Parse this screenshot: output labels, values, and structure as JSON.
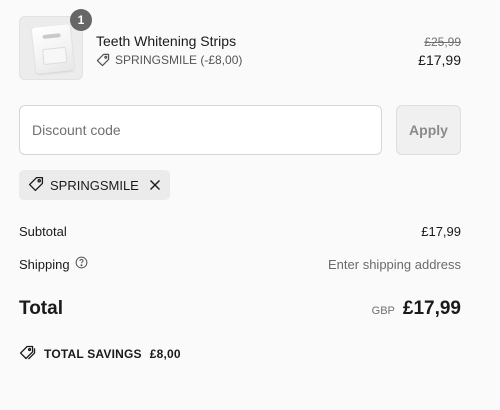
{
  "product": {
    "quantity": "1",
    "name": "Teeth Whitening Strips",
    "discount_label": "SPRINGSMILE (-£8,00)",
    "original_price": "£25,99",
    "price": "£17,99",
    "thumbnail_icon": "product-thumbnail"
  },
  "discount": {
    "placeholder": "Discount code",
    "value": "",
    "apply_label": "Apply",
    "applied_code": "SPRINGSMILE"
  },
  "summary": {
    "subtotal_label": "Subtotal",
    "subtotal_value": "£17,99",
    "shipping_label": "Shipping",
    "shipping_value": "Enter shipping address",
    "total_label": "Total",
    "total_currency": "GBP",
    "total_value": "£17,99",
    "savings_label": "TOTAL SAVINGS",
    "savings_value": "£8,00"
  },
  "colors": {
    "background": "#fafafa",
    "badge": "#666666",
    "chip": "#ebebeb",
    "text": "#1a1a1a",
    "muted": "#707070"
  },
  "icons": [
    "tag-icon",
    "question-circle-icon",
    "close-icon",
    "tags-icon"
  ]
}
